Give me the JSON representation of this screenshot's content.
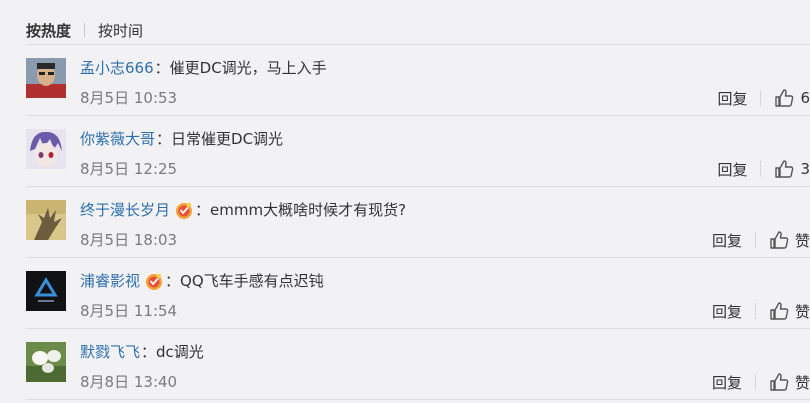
{
  "sort": {
    "hot_label": "按热度",
    "time_label": "按时间"
  },
  "comments": [
    {
      "username": "孟小志666",
      "colon": "：",
      "text": "催更DC调光，马上入手",
      "time": "8月5日 10:53",
      "reply": "回复",
      "like": "6",
      "badge": false,
      "avatar": "man-photo"
    },
    {
      "username": "你紫薇大哥",
      "colon": "：",
      "text": "日常催更DC调光",
      "time": "8月5日 12:25",
      "reply": "回复",
      "like": "3",
      "badge": false,
      "avatar": "anime-character"
    },
    {
      "username": "终于漫长岁月",
      "colon": "：",
      "text": "emmm大概啥时候才有现货?",
      "time": "8月5日 18:03",
      "reply": "回复",
      "like": "赞",
      "badge": true,
      "avatar": "hand-shadow"
    },
    {
      "username": "浦睿影视",
      "colon": "：",
      "text": "QQ飞车手感有点迟钝",
      "time": "8月5日 11:54",
      "reply": "回复",
      "like": "赞",
      "badge": true,
      "avatar": "studio-logo"
    },
    {
      "username": "默戮飞飞",
      "colon": "：",
      "text": "dc调光",
      "time": "8月8日 13:40",
      "reply": "回复",
      "like": "赞",
      "badge": false,
      "avatar": "white-flowers"
    }
  ],
  "colors": {
    "username": "#2f6fad",
    "text": "#333333",
    "time": "#7a7a7a",
    "background": "#f2f2f5"
  },
  "icons": {
    "like": "thumbs-up-icon",
    "badge": "fan-badge-icon"
  }
}
